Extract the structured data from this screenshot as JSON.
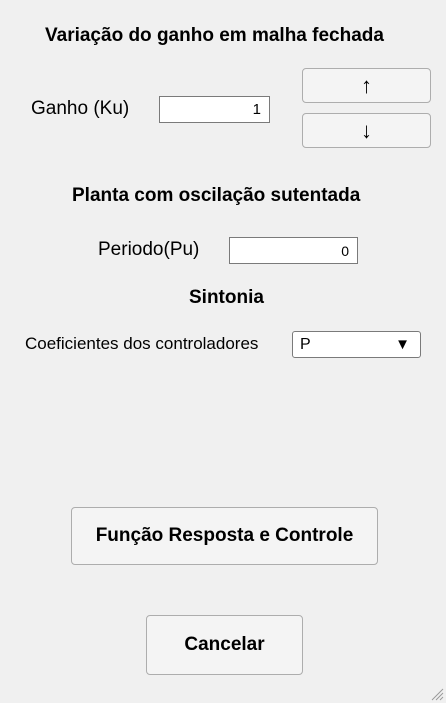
{
  "gain_section": {
    "title": "Variação do ganho em malha fechada",
    "gain_label": "Ganho (Ku)",
    "gain_value": "1",
    "up_label": "↑",
    "down_label": "↓"
  },
  "oscillation_section": {
    "title": "Planta com oscilação sutentada",
    "period_label": "Periodo(Pu)",
    "period_value": "0"
  },
  "tuning_section": {
    "title": "Sintonia",
    "coef_label": "Coeficientes dos controladores",
    "controller_selected": "P",
    "dropdown_caret": "▼"
  },
  "actions": {
    "response_button": "Função Resposta e Controle",
    "cancel_button": "Cancelar"
  },
  "icons": {
    "up": "arrow-up-icon",
    "down": "arrow-down-icon",
    "caret": "caret-down-icon",
    "resize": "resize-grip-icon"
  }
}
